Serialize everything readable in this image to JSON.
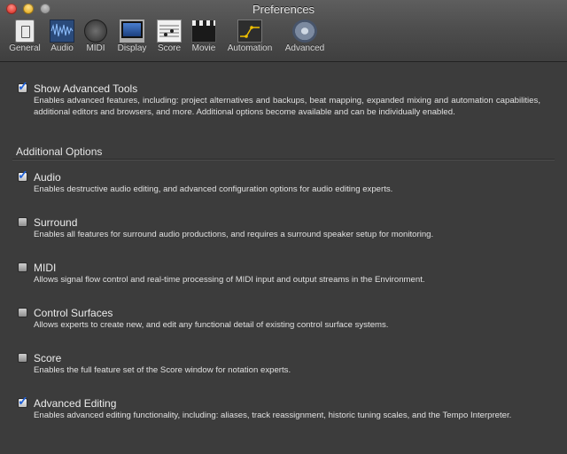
{
  "window": {
    "title": "Preferences"
  },
  "toolbar": {
    "items": [
      {
        "label": "General",
        "icon": "general-icon"
      },
      {
        "label": "Audio",
        "icon": "audio-icon"
      },
      {
        "label": "MIDI",
        "icon": "midi-icon"
      },
      {
        "label": "Display",
        "icon": "display-icon"
      },
      {
        "label": "Score",
        "icon": "score-icon"
      },
      {
        "label": "Movie",
        "icon": "movie-icon"
      },
      {
        "label": "Automation",
        "icon": "automation-icon"
      },
      {
        "label": "Advanced",
        "icon": "advanced-gear-icon",
        "selected": true
      }
    ]
  },
  "advanced": {
    "show_tools": {
      "checked": true,
      "label": "Show Advanced Tools",
      "desc": "Enables advanced features, including: project alternatives and backups, beat mapping, expanded mixing and automation capabilities, additional editors and browsers, and more. Additional options become available and can be individually enabled."
    },
    "section_title": "Additional Options",
    "options": [
      {
        "checked": true,
        "label": "Audio",
        "desc": "Enables destructive audio editing, and advanced configuration options for audio editing experts."
      },
      {
        "checked": false,
        "label": "Surround",
        "desc": "Enables all features for surround audio productions, and requires a surround speaker setup for monitoring."
      },
      {
        "checked": false,
        "label": "MIDI",
        "desc": "Allows signal flow control and real-time processing of MIDI input and output streams in the Environment."
      },
      {
        "checked": false,
        "label": "Control Surfaces",
        "desc": "Allows experts to create new, and edit any functional detail of existing control surface systems."
      },
      {
        "checked": false,
        "label": "Score",
        "desc": "Enables the full feature set of the Score window for notation experts."
      },
      {
        "checked": true,
        "label": "Advanced Editing",
        "desc": "Enables advanced editing functionality, including: aliases, track reassignment, historic tuning scales, and the Tempo Interpreter."
      }
    ]
  },
  "colors": {
    "checkmark": "#1f5fd6",
    "background": "#3c3c3c"
  }
}
